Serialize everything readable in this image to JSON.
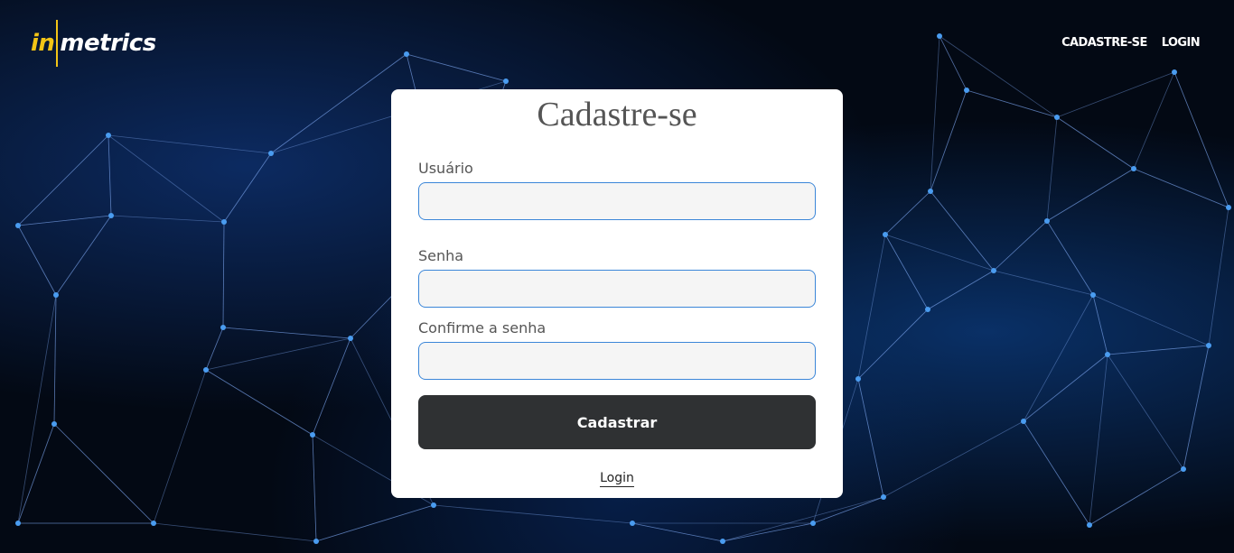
{
  "brand": {
    "logo_in": "in",
    "logo_metrics": "metrics",
    "accent_color": "#f3c516"
  },
  "nav": {
    "register_label": "CADASTRE-SE",
    "login_label": "LOGIN"
  },
  "form": {
    "title": "Cadastre-se",
    "username_label": "Usuário",
    "username_value": "",
    "password_label": "Senha",
    "password_value": "",
    "confirm_label": "Confirme a senha",
    "confirm_value": "",
    "submit_label": "Cadastrar",
    "login_link": "Login",
    "button_color": "#2f3133",
    "field_border_color": "#3b86d8"
  }
}
